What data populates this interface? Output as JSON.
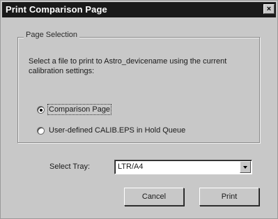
{
  "window": {
    "title": "Print Comparison Page",
    "close_glyph": "×"
  },
  "page_selection": {
    "legend": "Page Selection",
    "description": "Select a file to print to Astro_devicename using the current calibration settings:",
    "options": [
      {
        "label": "Comparison Page",
        "selected": true
      },
      {
        "label": "User-defined CALIB.EPS in Hold Queue",
        "selected": false
      }
    ]
  },
  "tray": {
    "label": "Select Tray:",
    "value": "LTR/A4"
  },
  "buttons": {
    "cancel": "Cancel",
    "print": "Print"
  },
  "icons": {
    "close": "close-icon",
    "dropdown": "chevron-down-icon"
  }
}
